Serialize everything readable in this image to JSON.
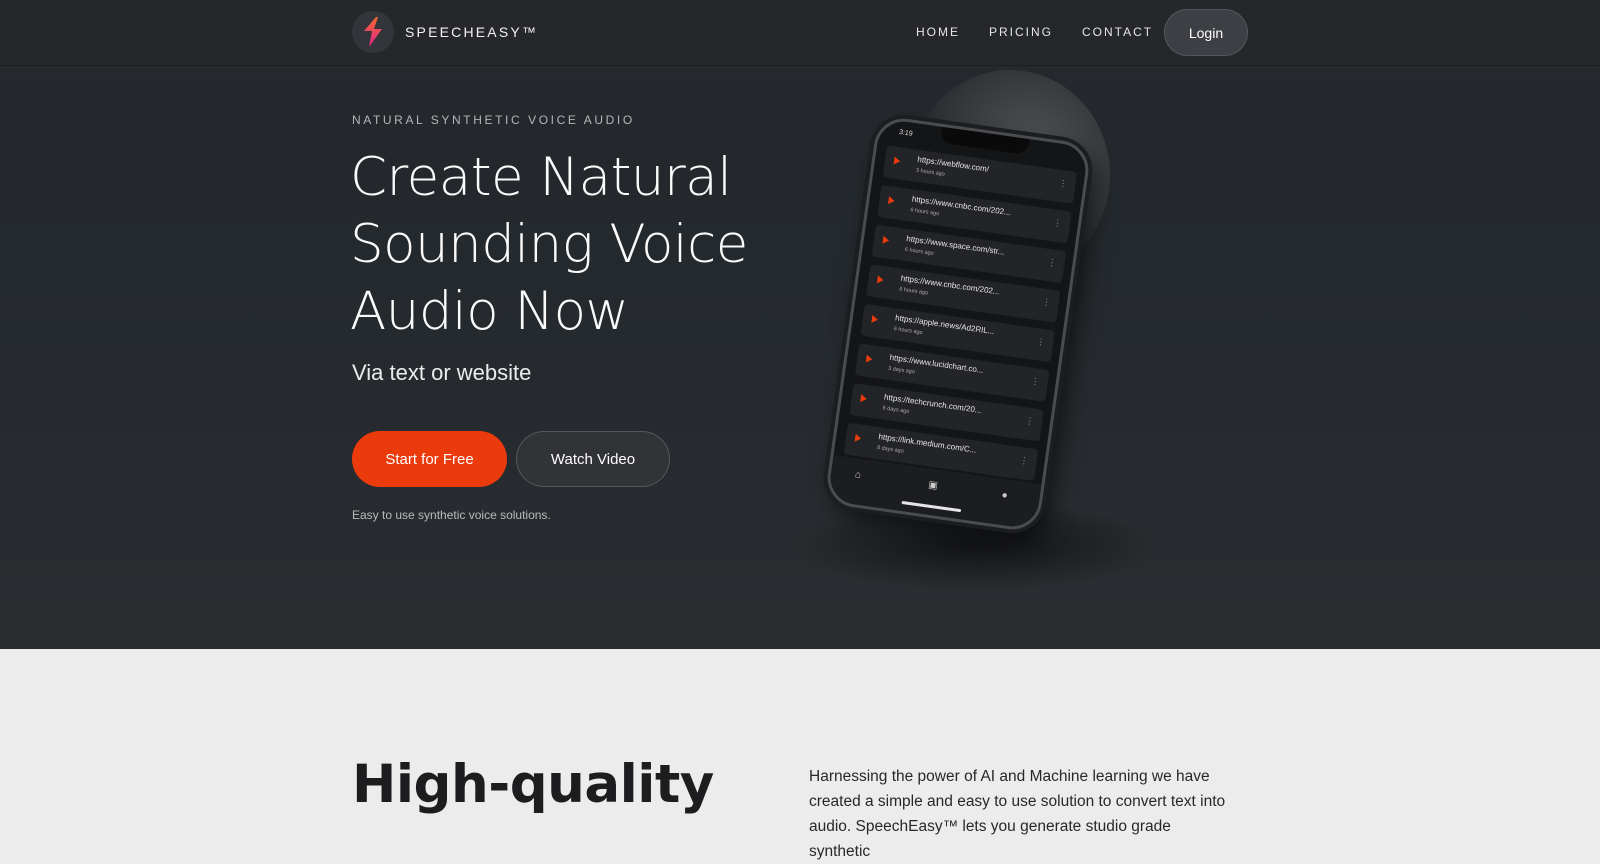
{
  "nav": {
    "brand": "SPEECHEASY™",
    "links": [
      "HOME",
      "PRICING",
      "CONTACT"
    ],
    "login": "Login"
  },
  "hero": {
    "eyebrow": "NATURAL SYNTHETIC VOICE AUDIO",
    "headline_lines": [
      "Create Natural",
      "Sounding Voice",
      "Audio Now"
    ],
    "subheadline": "Via text or website",
    "primary_cta": "Start for Free",
    "secondary_cta": "Watch Video",
    "tagline": "Easy to use synthetic voice solutions."
  },
  "phone": {
    "time": "3:19",
    "items": [
      {
        "url": "https://webflow.com/",
        "ago": "3 hours ago"
      },
      {
        "url": "https://www.cnbc.com/202...",
        "ago": "6 hours ago"
      },
      {
        "url": "https://www.space.com/str...",
        "ago": "6 hours ago"
      },
      {
        "url": "https://www.cnbc.com/202...",
        "ago": "6 hours ago"
      },
      {
        "url": "https://apple.news/Ad2RIL...",
        "ago": "6 hours ago"
      },
      {
        "url": "https://www.lucidchart.co...",
        "ago": "3 days ago"
      },
      {
        "url": "https://techcrunch.com/20...",
        "ago": "6 days ago"
      },
      {
        "url": "https://link.medium.com/C...",
        "ago": "8 days ago"
      }
    ]
  },
  "features": {
    "heading": "High-quality",
    "paragraph": "Harnessing the power of AI and Machine learning we have created a simple and easy to use solution to convert text into audio. SpeechEasy™ lets you generate studio grade synthetic"
  },
  "colors": {
    "accent": "#eb3a0c",
    "hero_bg": "#25272b",
    "lower_bg": "#ececec"
  },
  "icons": [
    "logo-bolt-icon",
    "play-icon",
    "more-dots-icon",
    "home-icon",
    "library-icon",
    "profile-icon"
  ]
}
